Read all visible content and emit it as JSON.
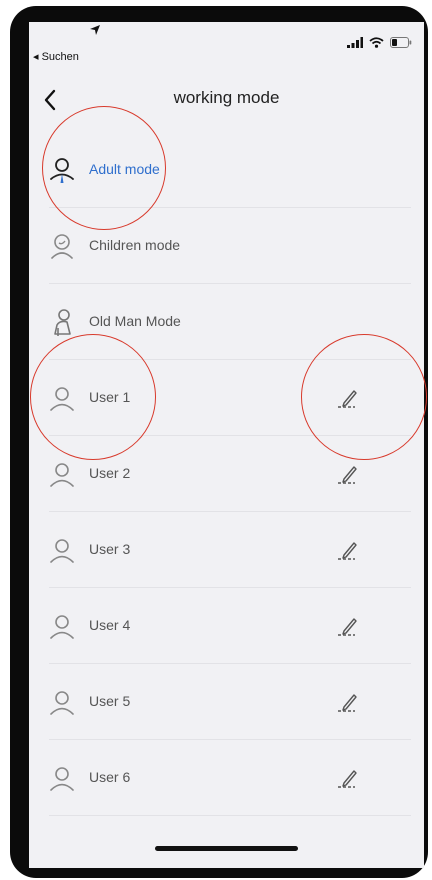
{
  "status_bar": {
    "back_app_label": "◂ Suchen",
    "icons": [
      "location-arrow-icon",
      "signal-icon",
      "wifi-icon",
      "battery-icon"
    ]
  },
  "navbar": {
    "back_icon": "chevron-left-icon",
    "title": "working mode"
  },
  "modes": [
    {
      "label": "Adult mode",
      "icon": "adult-person-icon",
      "active": true,
      "editable": false
    },
    {
      "label": "Children mode",
      "icon": "child-face-icon",
      "active": false,
      "editable": false
    },
    {
      "label": "Old Man Mode",
      "icon": "old-man-icon",
      "active": false,
      "editable": false
    },
    {
      "label": "User 1",
      "icon": "user-icon",
      "active": false,
      "editable": true
    },
    {
      "label": "User 2",
      "icon": "user-icon",
      "active": false,
      "editable": true
    },
    {
      "label": "User 3",
      "icon": "user-icon",
      "active": false,
      "editable": true
    },
    {
      "label": "User 4",
      "icon": "user-icon",
      "active": false,
      "editable": true
    },
    {
      "label": "User 5",
      "icon": "user-icon",
      "active": false,
      "editable": true
    },
    {
      "label": "User 6",
      "icon": "user-icon",
      "active": false,
      "editable": true
    }
  ],
  "colors": {
    "active": "#2f6fcd",
    "annotation": "#d83a2c",
    "background": "#f1f1f4"
  }
}
